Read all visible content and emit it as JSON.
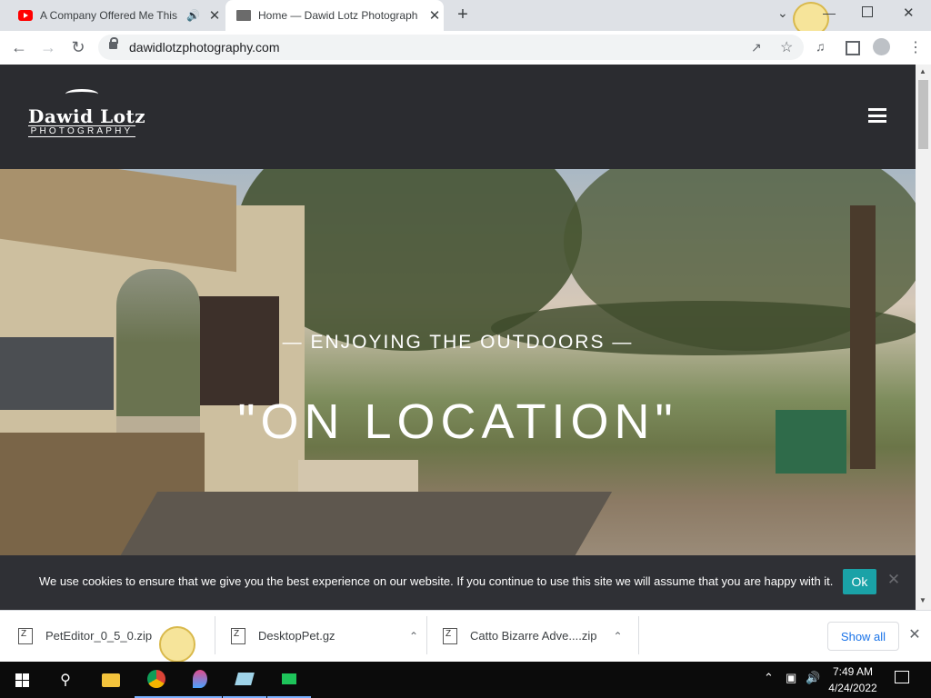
{
  "browser": {
    "tabs": [
      {
        "title": "A Company Offered Me This"
      },
      {
        "title": "Home — Dawid Lotz Photograph"
      }
    ],
    "url": "dawidlotzphotography.com"
  },
  "site": {
    "logo_name": "Dawid Lotz",
    "logo_sub": "PHOTOGRAPHY",
    "hero_subheading": "— ENJOYING THE OUTDOORS —",
    "hero_headline": "\"ON LOCATION\""
  },
  "cookie": {
    "text": "We use cookies to ensure that we give you the best experience on our website. If you continue to use this site we will assume that you are happy with it.",
    "ok_label": "Ok"
  },
  "downloads": {
    "items": [
      {
        "name": "PetEditor_0_5_0.zip"
      },
      {
        "name": "DesktopPet.gz"
      },
      {
        "name": "Catto Bizarre Adve....zip"
      }
    ],
    "show_all": "Show all"
  },
  "taskbar": {
    "time": "7:49 AM",
    "date": "4/24/2022"
  },
  "colors": {
    "site_header": "#2b2c30",
    "cookie_ok": "#1aa2a7",
    "link_blue": "#1a73e8"
  }
}
